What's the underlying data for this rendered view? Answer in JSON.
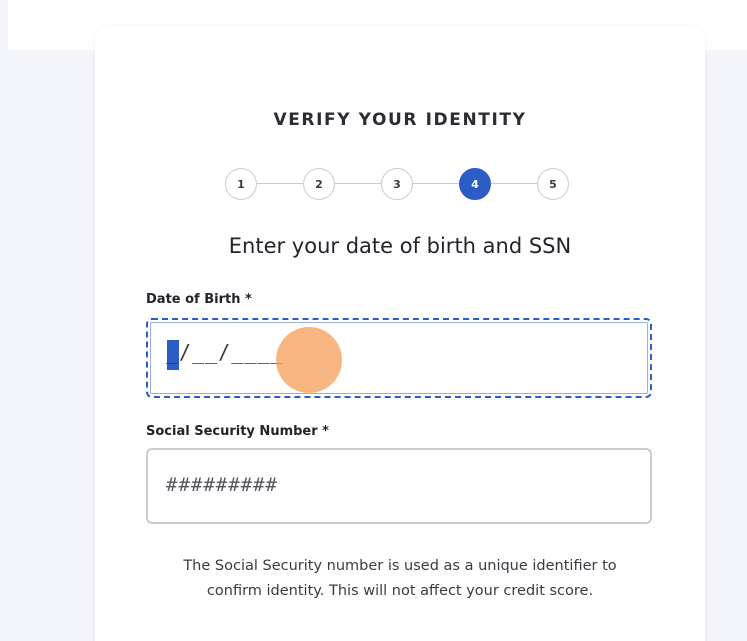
{
  "header": {
    "title": "VERIFY YOUR IDENTITY"
  },
  "stepper": {
    "steps": [
      "1",
      "2",
      "3",
      "4",
      "5"
    ],
    "active_step": "4"
  },
  "form": {
    "subtitle": "Enter your date of birth and SSN",
    "dob": {
      "label": "Date of Birth *",
      "value": "_/__/____"
    },
    "ssn": {
      "label": "Social Security Number *",
      "placeholder": "#########"
    },
    "note": "The Social Security number is used as a unique identifier to confirm identity. This will not affect your credit score."
  },
  "colors": {
    "accent": "#2c5cc5",
    "tap_indicator": "#f5a05f"
  }
}
